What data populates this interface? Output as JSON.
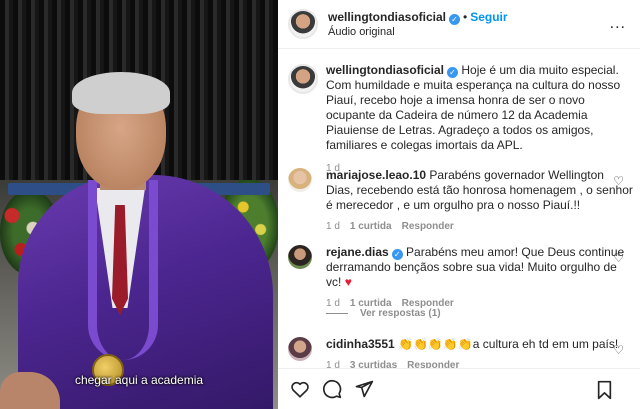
{
  "video": {
    "subtitle": "chegar aqui a academia"
  },
  "header": {
    "username": "wellingtondiasoficial",
    "verified": "✓",
    "separator": "•",
    "follow_label": "Seguir",
    "audio_label": "Áudio original",
    "more": "..."
  },
  "caption": {
    "username": "wellingtondiasoficial",
    "text": "Hoje é um dia muito especial. Com humildade e muita esperança na cultura do nosso Piauí, recebo hoje a imensa honra de ser o novo ocupante da Cadeira de número 12 da Academia Piauiense de Letras. Agradeço a todos os amigos, familiares e colegas imortais da APL.",
    "time": "1 d"
  },
  "comments": [
    {
      "username": "mariajose.leao.10",
      "text": "Parabéns governador Wellington Dias, recebendo está tão honrosa homenagem , o senhor é merecedor , e um orgulho pra o nosso Piauí.!!",
      "time": "1 d",
      "likes": "1 curtida",
      "reply": "Responder"
    },
    {
      "username": "rejane.dias",
      "text": "Parabéns meu amor! Que Deus continue derramando bençãos sobre sua vida! Muito orgulho de vc!",
      "time": "1 d",
      "likes": "1 curtida",
      "reply": "Responder"
    },
    {
      "username": "cidinha3551",
      "emojis": "👏👏👏👏👏",
      "text": "a cultura eh td em um país!",
      "time": "1 d",
      "likes": "3 curtidas",
      "reply": "Responder"
    }
  ],
  "view_replies": "Ver respostas (1)",
  "icons": {
    "heart": "♡",
    "red_heart": "♥"
  },
  "colors": {
    "accent": "#0095f6",
    "verified": "#3897f0",
    "muted": "#8e8e8e",
    "love": "#ed1a33"
  }
}
